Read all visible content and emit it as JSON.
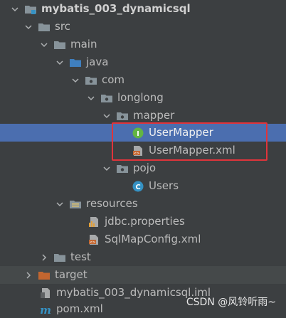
{
  "tree": {
    "items": [
      {
        "label": "mybatis_003_dynamicsql",
        "icon": "module-folder-icon"
      },
      {
        "label": "src",
        "icon": "folder-icon"
      },
      {
        "label": "main",
        "icon": "folder-icon"
      },
      {
        "label": "java",
        "icon": "source-folder-icon"
      },
      {
        "label": "com",
        "icon": "package-icon"
      },
      {
        "label": "longlong",
        "icon": "package-icon"
      },
      {
        "label": "mapper",
        "icon": "package-icon"
      },
      {
        "label": "UserMapper",
        "icon": "interface-icon"
      },
      {
        "label": "UserMapper.xml",
        "icon": "xml-file-icon"
      },
      {
        "label": "pojo",
        "icon": "package-icon"
      },
      {
        "label": "Users",
        "icon": "class-icon"
      },
      {
        "label": "resources",
        "icon": "resources-folder-icon"
      },
      {
        "label": "jdbc.properties",
        "icon": "properties-file-icon"
      },
      {
        "label": "SqlMapConfig.xml",
        "icon": "xml-file-icon"
      },
      {
        "label": "test",
        "icon": "folder-icon"
      },
      {
        "label": "target",
        "icon": "excluded-folder-icon"
      },
      {
        "label": "mybatis_003_dynamicsql.iml",
        "icon": "iml-file-icon"
      },
      {
        "label": "pom.xml",
        "icon": "maven-icon"
      }
    ],
    "selected": "UserMapper"
  },
  "watermark": "CSDN @风铃听雨~",
  "colors": {
    "background": "#3c3f41",
    "selection": "#4b6eaf",
    "highlight_border": "#e0343b",
    "folder": "#87939a",
    "target_folder": "#c26630",
    "interface": "#62b543",
    "class": "#3592c4"
  }
}
